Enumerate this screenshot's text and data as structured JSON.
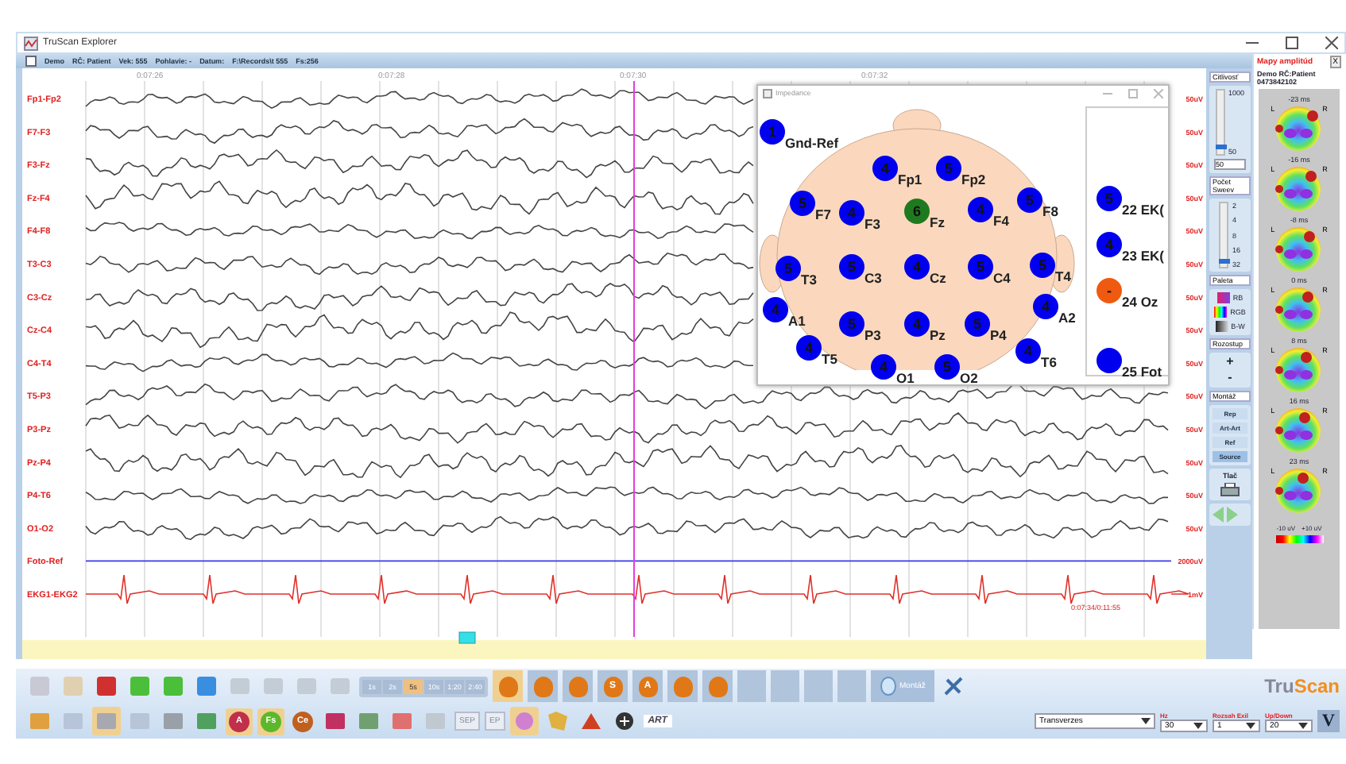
{
  "window": {
    "title": "TruScan Explorer"
  },
  "header": [
    "Demo",
    "RČ: Patient",
    "Vek: 555",
    "Pohlavie: -",
    "Datum:",
    "F:\\Records\\t 555",
    "Fs:256"
  ],
  "eeg": {
    "time_labels": [
      "0:07:26",
      "0:07:28",
      "0:07:30",
      "0:07:32"
    ],
    "channels": [
      {
        "label": "Fp1-Fp2",
        "scale": "50uV",
        "kind": "eeg"
      },
      {
        "label": "F7-F3",
        "scale": "50uV",
        "kind": "eeg"
      },
      {
        "label": "F3-Fz",
        "scale": "50uV",
        "kind": "eeg"
      },
      {
        "label": "Fz-F4",
        "scale": "50uV",
        "kind": "eeg"
      },
      {
        "label": "F4-F8",
        "scale": "50uV",
        "kind": "eeg"
      },
      {
        "label": "T3-C3",
        "scale": "50uV",
        "kind": "eeg"
      },
      {
        "label": "C3-Cz",
        "scale": "50uV",
        "kind": "eeg"
      },
      {
        "label": "Cz-C4",
        "scale": "50uV",
        "kind": "eeg"
      },
      {
        "label": "C4-T4",
        "scale": "50uV",
        "kind": "eeg"
      },
      {
        "label": "T5-P3",
        "scale": "50uV",
        "kind": "eeg"
      },
      {
        "label": "P3-Pz",
        "scale": "50uV",
        "kind": "eeg"
      },
      {
        "label": "Pz-P4",
        "scale": "50uV",
        "kind": "eeg"
      },
      {
        "label": "P4-T6",
        "scale": "50uV",
        "kind": "eeg"
      },
      {
        "label": "O1-O2",
        "scale": "50uV",
        "kind": "eeg"
      },
      {
        "label": "Foto-Ref",
        "scale": "2000uV",
        "kind": "photic"
      },
      {
        "label": "EKG1-EKG2",
        "scale": "1mV",
        "kind": "ekg"
      }
    ],
    "position_text": "0:07:34/0:11:55"
  },
  "impedance": {
    "title": "Impedance",
    "electrodes": [
      {
        "value": "1",
        "label": "Gnd-Ref",
        "color": "#0000ee"
      },
      {
        "value": "4",
        "label": "Fp1",
        "color": "#0000ee"
      },
      {
        "value": "5",
        "label": "Fp2",
        "color": "#0000ee"
      },
      {
        "value": "5",
        "label": "F7",
        "color": "#0000ee"
      },
      {
        "value": "4",
        "label": "F3",
        "color": "#0000ee"
      },
      {
        "value": "6",
        "label": "Fz",
        "color": "#1f7a1f"
      },
      {
        "value": "4",
        "label": "F4",
        "color": "#0000ee"
      },
      {
        "value": "5",
        "label": "F8",
        "color": "#0000ee"
      },
      {
        "value": "5",
        "label": "T3",
        "color": "#0000ee"
      },
      {
        "value": "5",
        "label": "C3",
        "color": "#0000ee"
      },
      {
        "value": "4",
        "label": "Cz",
        "color": "#0000ee"
      },
      {
        "value": "5",
        "label": "C4",
        "color": "#0000ee"
      },
      {
        "value": "5",
        "label": "T4",
        "color": "#0000ee"
      },
      {
        "value": "4",
        "label": "A1",
        "color": "#0000ee"
      },
      {
        "value": "5",
        "label": "P3",
        "color": "#0000ee"
      },
      {
        "value": "4",
        "label": "Pz",
        "color": "#0000ee"
      },
      {
        "value": "5",
        "label": "P4",
        "color": "#0000ee"
      },
      {
        "value": "4",
        "label": "A2",
        "color": "#0000ee"
      },
      {
        "value": "4",
        "label": "T5",
        "color": "#0000ee"
      },
      {
        "value": "4",
        "label": "T6",
        "color": "#0000ee"
      },
      {
        "value": "4",
        "label": "O1",
        "color": "#0000ee"
      },
      {
        "value": "5",
        "label": "O2",
        "color": "#0000ee"
      }
    ],
    "side_electrodes": [
      {
        "value": "5",
        "label": "22 EK(",
        "color": "#0000ee"
      },
      {
        "value": "4",
        "label": "23 EK(",
        "color": "#0000ee"
      },
      {
        "value": "-",
        "label": "24 Oz",
        "color": "#f05a10"
      },
      {
        "label": "25 Fot",
        "color": "#0000ee"
      }
    ]
  },
  "controls": {
    "sensitivity": {
      "title": "Citlivosť",
      "max": "1000",
      "thumb_value": "50",
      "level": 0.08,
      "spinner": "50"
    },
    "sweeps": {
      "title": "Počet Sweev",
      "values": [
        "2",
        "4",
        "8",
        "16",
        "32"
      ],
      "level": 0.05
    },
    "palette": {
      "title": "Paleta",
      "items": [
        {
          "label": "RB",
          "kind": "rb"
        },
        {
          "label": "RGB",
          "kind": "rgb"
        },
        {
          "label": "B-W",
          "kind": "bw"
        }
      ]
    },
    "spacing": {
      "title": "Rozostup",
      "buttons": [
        "+",
        "-"
      ]
    },
    "montage": {
      "title": "Montáž",
      "items": [
        {
          "label": "Rep",
          "selected": false
        },
        {
          "label": "Art-Art",
          "selected": false
        },
        {
          "label": "Ref",
          "selected": false
        },
        {
          "label": "Source",
          "selected": true
        }
      ]
    },
    "print": {
      "label": "Tlač"
    }
  },
  "maps": {
    "title": "Mapy amplitúd",
    "close": "X",
    "patient": "Demo   RČ:Patient",
    "id": "0473842102",
    "items": [
      {
        "time": "-23 ms",
        "left": "L",
        "right": "R"
      },
      {
        "time": "-16 ms",
        "left": "L",
        "right": "R"
      },
      {
        "time": "-8 ms",
        "left": "L",
        "right": "R"
      },
      {
        "time": "0 ms",
        "left": "L",
        "right": "R"
      },
      {
        "time": "8 ms",
        "left": "L",
        "right": "R"
      },
      {
        "time": "16 ms",
        "left": "L",
        "right": "R"
      },
      {
        "time": "23 ms",
        "left": "L",
        "right": "R"
      }
    ],
    "scale_min": "-10 uV",
    "scale_max": "+10 uV"
  },
  "toolbar": {
    "time_buttons": [
      {
        "label": "1s",
        "selected": false
      },
      {
        "label": "2s",
        "selected": false
      },
      {
        "label": "5s",
        "selected": true
      },
      {
        "label": "10s",
        "selected": false
      },
      {
        "label": "1:20",
        "selected": false
      },
      {
        "label": "2:40",
        "selected": false
      }
    ],
    "head_buttons": [
      {
        "selected": true
      },
      {
        "selected": false
      },
      {
        "selected": false
      },
      {
        "letter": "S",
        "selected": false
      },
      {
        "letter": "A",
        "selected": false
      },
      {
        "selected": false
      },
      {
        "selected": false
      }
    ],
    "montage_button": "Montáž",
    "filter_buttons": [
      {
        "letter": "A",
        "color": "#c0304a",
        "selected": true
      },
      {
        "letter": "Fs",
        "color": "#5cb82a",
        "selected": true
      },
      {
        "letter": "Ce",
        "color": "#c0601f",
        "selected": false
      }
    ],
    "ep_buttons": [
      "SEP",
      "EP"
    ],
    "art_button": "ART",
    "logo": {
      "first": "Tru",
      "second": "Scan"
    },
    "montage_select": "Transverzes",
    "selects": [
      {
        "label": "Hz",
        "value": "30"
      },
      {
        "label": "Rozsah Exil",
        "value": "1"
      },
      {
        "label": "Up/Down",
        "value": "20"
      }
    ],
    "v_button": "V"
  }
}
